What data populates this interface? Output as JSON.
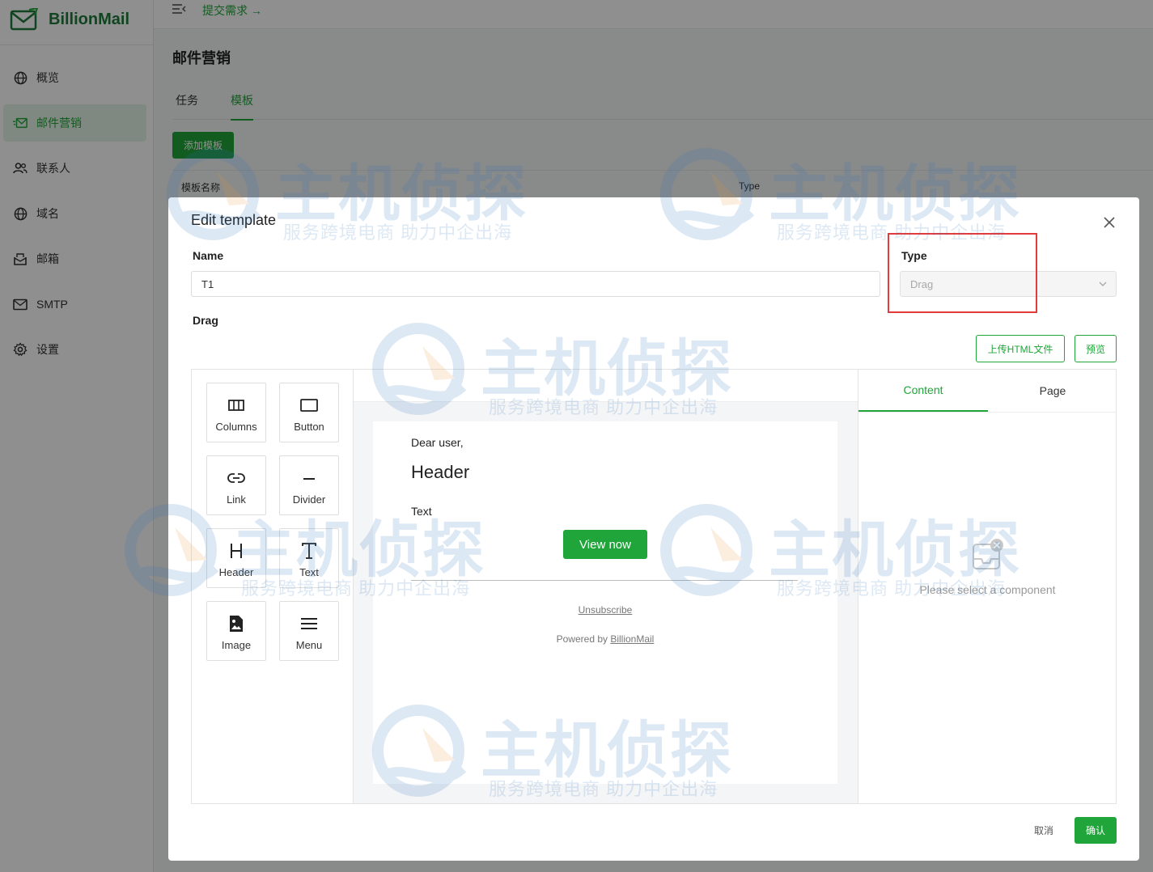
{
  "app": {
    "brand": "BillionMail",
    "brand_color": "#20a53a",
    "topbar": {
      "submit_link": "提交需求 →"
    },
    "sidebar": {
      "items": [
        {
          "label": "概览",
          "icon": "globe-icon"
        },
        {
          "label": "邮件营销",
          "icon": "mail-send-icon",
          "active": true
        },
        {
          "label": "联系人",
          "icon": "users-icon"
        },
        {
          "label": "域名",
          "icon": "globe-icon"
        },
        {
          "label": "邮箱",
          "icon": "mailbox-icon"
        },
        {
          "label": "SMTP",
          "icon": "envelope-icon"
        },
        {
          "label": "设置",
          "icon": "gear-icon"
        }
      ]
    },
    "page_title": "邮件营销",
    "tabs": [
      {
        "label": "任务"
      },
      {
        "label": "模板",
        "active": true
      }
    ],
    "add_template_label": "添加模板",
    "table_columns": [
      "模板名称",
      "Type"
    ]
  },
  "modal": {
    "title": "Edit template",
    "name_label": "Name",
    "name_value": "T1",
    "type_label": "Type",
    "type_value": "Drag",
    "drag_label": "Drag",
    "upload_html_label": "上传HTML文件",
    "preview_label": "预览",
    "palette": [
      {
        "label": "Columns",
        "icon": "columns-icon"
      },
      {
        "label": "Button",
        "icon": "button-icon"
      },
      {
        "label": "Link",
        "icon": "link-icon"
      },
      {
        "label": "Divider",
        "icon": "divider-icon"
      },
      {
        "label": "Header",
        "icon": "header-icon"
      },
      {
        "label": "Text",
        "icon": "text-icon"
      },
      {
        "label": "Image",
        "icon": "image-icon"
      },
      {
        "label": "Menu",
        "icon": "menu-icon"
      }
    ],
    "email": {
      "greeting": "Dear user,",
      "header": "Header",
      "text": "Text",
      "button": "View now",
      "unsubscribe": "Unsubscribe",
      "powered_prefix": "Powered by ",
      "powered_brand": "BillionMail"
    },
    "props_tabs": [
      {
        "label": "Content",
        "active": true
      },
      {
        "label": "Page"
      }
    ],
    "empty_text": "Please select a component",
    "cancel_label": "取消",
    "confirm_label": "确认"
  },
  "watermark": {
    "main": "主机侦探",
    "sub": "服务跨境电商 助力中企出海"
  }
}
